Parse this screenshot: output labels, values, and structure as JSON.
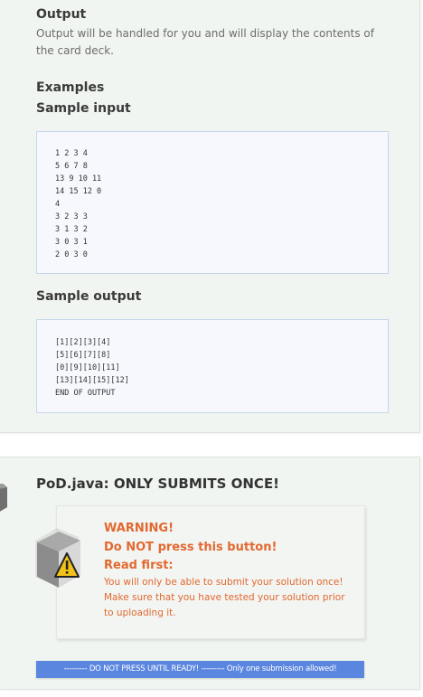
{
  "output": {
    "heading": "Output",
    "description": "Output will be handled for you and will display the contents of the card deck."
  },
  "examples": {
    "heading": "Examples",
    "sample_input_heading": "Sample input",
    "sample_input": "1 2 3 4\n5 6 7 8\n13 9 10 11\n14 15 12 0\n4\n3 2 3 3\n3 1 3 2\n3 0 3 1\n2 0 3 0",
    "sample_output_heading": "Sample output",
    "sample_output": "[1][2][3][4]\n[5][6][7][8]\n[0][9][10][11]\n[13][14][15][12]\nEND OF OUTPUT"
  },
  "submission": {
    "title": "PoD.java: ONLY SUBMITS ONCE!",
    "warning_title": "WARNING!",
    "warning_subtitle": "Do NOT press this button!",
    "read_first": "Read first:",
    "warning_body": "You will only be able to submit your solution once! Make sure that you have tested your solution prior to uploading it.",
    "button_label": "--------- DO NOT PRESS UNTIL READY! --------- Only one submission allowed!"
  },
  "colors": {
    "warning": "#e36830",
    "button": "#5b86e0",
    "card_bg": "#f1f5f1"
  }
}
